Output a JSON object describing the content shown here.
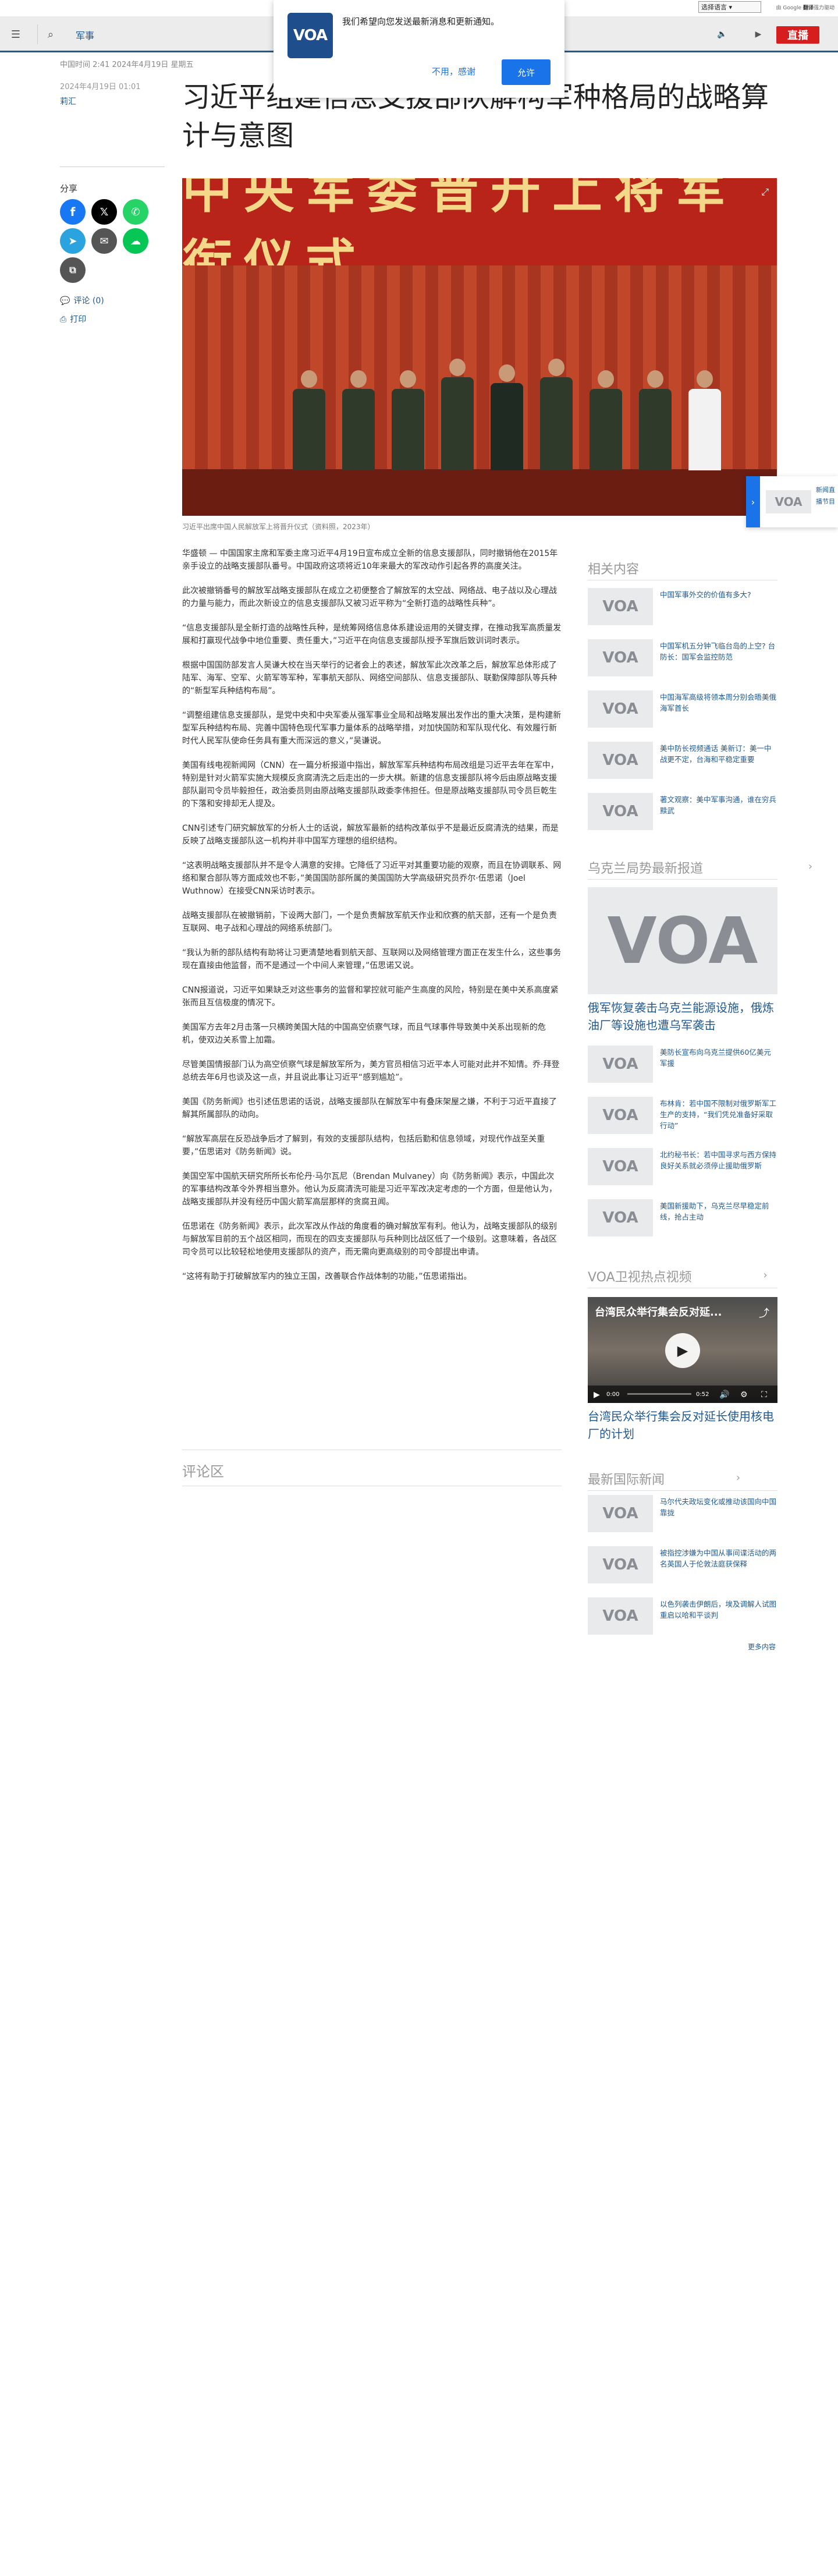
{
  "translate": {
    "select_value": "选择语言",
    "powered_by": "由",
    "brand": "Google",
    "service": "翻译",
    "action": "强力驱动"
  },
  "header": {
    "section": "军事",
    "live_label": "直播"
  },
  "notification": {
    "message": "我们希望向您发送最新消息和更新通知。",
    "decline": "不用，感谢",
    "accept": "允许",
    "logo_text": "VOA"
  },
  "article": {
    "dateline": "中国时间 2:41 2024年4月19日 星期五",
    "pubdate": "2024年4月19日 01:01",
    "author": "莉汇",
    "title": "习近平组建信息支援部队解构军种格局的战略算计与意图",
    "hero_banner_text": "中央军委晋升上将军衔仪式",
    "caption": "习近平出席中国人民解放军上将晋升仪式（资料照，2023年）",
    "paragraphs": [
      "华盛顿 — 中国国家主席和军委主席习近平4月19日宣布成立全新的信息支援部队，同时撤销他在2015年亲手设立的战略支援部队番号。中国政府这项将近10年来最大的军改动作引起各界的高度关注。",
      "此次被撤销番号的解放军战略支援部队在成立之初便整合了解放军的太空战、网络战、电子战以及心理战的力量与能力，而此次新设立的信息支援部队又被习近平称为“全新打造的战略性兵种”。",
      "“信息支援部队是全新打造的战略性兵种，是统筹网络信息体系建设运用的关键支撑，在推动我军高质量发展和打赢现代战争中地位重要、责任重大，”习近平在向信息支援部队授予军旗后致训词时表示。",
      "根据中国国防部发言人吴谦大校在当天举行的记者会上的表述，解放军此次改革之后，解放军总体形成了陆军、海军、空军、火箭军等军种，军事航天部队、网络空间部队、信息支援部队、联勤保障部队等兵种的“新型军兵种结构布局”。",
      "“调整组建信息支援部队，是党中央和中央军委从强军事业全局和战略发展出发作出的重大决策，是构建新型军兵种结构布局、完善中国特色现代军事力量体系的战略举措，对加快国防和军队现代化、有效履行新时代人民军队使命任务具有重大而深远的意义，”吴谦说。",
      "美国有线电视新闻网（CNN）在一篇分析报道中指出，解放军军兵种结构布局改组是习近平去年在军中，特别是针对火箭军实施大规模反贪腐清洗之后走出的一步大棋。新建的信息支援部队将今后由原战略支援部队副司令员毕毅担任，政治委员则由原战略支援部队政委李伟担任。但是原战略支援部队司令员巨乾生的下落和安排却无人提及。",
      "CNN引述专门研究解放军的分析人士的话说，解放军最新的结构改革似乎不是最近反腐清洗的结果，而是反映了战略支援部队这一机构并非中国军方理想的组织结构。",
      "“这表明战略支援部队并不是令人满意的安排。它降低了习近平对其重要功能的观察，而且在协调联系、网络和聚合部队等方面成效也不彰，”美国国防部所属的美国国防大学高级研究员乔尔·伍思诺（Joel Wuthnow）在接受CNN采访时表示。",
      "战略支援部队在被撤销前，下设两大部门，一个是负责解放军航天作业和欣赛的航天部，还有一个是负责互联网、电子战和心理战的网络系统部门。",
      "“我认为新的部队结构有助将让习更清楚地看到航天部、互联网以及网络管理方面正在发生什么，这些事务现在直接由他监督，而不是通过一个中间人来管理，”伍思诺又说。",
      "CNN报道说，习近平如果缺乏对这些事务的监督和掌控就可能产生高度的风险，特别是在美中关系高度紧张而且互信极度的情况下。",
      "美国军方去年2月击落一只横跨美国大陆的中国高空侦察气球，而且气球事件导致美中关系出现新的危机，使双边关系雪上加霜。",
      "尽管美国情报部门认为高空侦察气球是解放军所为，美方官员相信习近平本人可能对此并不知情。乔·拜登总统去年6月也谈及这一点，并且说此事让习近平“感到尴尬”。",
      "美国《防务新闻》也引述伍思诺的话说，战略支援部队在解放军中有叠床架屋之嫌，不利于习近平直接了解其所属部队的动向。",
      "“解放军高层在反恐战争后才了解到，有效的支援部队结构，包括后勤和信息领域，对现代作战至关重要，”伍思诺对《防务新闻》说。",
      "美国空军中国航天研究所所长布伦丹·马尔瓦尼（Brendan Mulvaney）向《防务新闻》表示，中国此次的军事结构改革令外界相当意外。他认为反腐清洗可能是习近平军改决定考虑的一个方面，但是他认为，战略支援部队并没有经历中国火箭军高层那样的贪腐丑闻。",
      "伍思诺在《防务新闻》表示，此次军改从作战的角度看的确对解放军有利。他认为，战略支援部队的级别与解放军目前的五个战区相同，而现在的四支支援部队与兵种则比战区低了一个级别。这意味着，各战区司令员可以比较轻松地使用支援部队的资产，而无需向更高级别的司令部提出申请。",
      "“这将有助于打破解放军内的独立王国，改善联合作战体制的功能，”伍思诺指出。"
    ],
    "comments_label": "评论区"
  },
  "share": {
    "label": "分享",
    "comments_link": "评论 (0)",
    "print_link": "打印"
  },
  "float_widget": {
    "logo_text": "VOA",
    "text": "新闻直播节目"
  },
  "sidebar": {
    "related": {
      "title": "相关内容",
      "items": [
        {
          "thumb": "VOA",
          "text": "中国军事外交的价值有多大?"
        },
        {
          "thumb": "VOA",
          "text": "中国军机五分钟飞临台岛的上空? 台防长：国军会监控防范"
        },
        {
          "thumb": "VOA",
          "text": "中国海军高级将领本周分别会晤美俄海军首长"
        },
        {
          "thumb": "VOA",
          "text": "美中防长视频通话 美新订：美一中战更不定，台海和平稳定重要"
        },
        {
          "thumb": "VOA",
          "text": "著文观察：美中军事沟通，谁在穷兵黩武"
        }
      ]
    },
    "ukraine": {
      "title": "乌克兰局势最新报道",
      "feature_thumb": "VOA",
      "feature_text": "俄军恢复袭击乌克兰能源设施，俄炼油厂等设施也遭乌军袭击",
      "items": [
        {
          "thumb": "VOA",
          "text": "美防长宣布向乌克兰提供60亿美元军援"
        },
        {
          "thumb": "VOA",
          "text": "布林肯：若中国不限制对俄罗斯军工生产的支持，“我们凭兑准备好采取行动”"
        },
        {
          "thumb": "VOA",
          "text": "北约秘书长：若中国寻求与西方保持良好关系就必须停止援助俄罗斯"
        },
        {
          "thumb": "VOA",
          "text": "美国新援助下，乌克兰尽早稳定前线，抢占主动"
        }
      ]
    },
    "video": {
      "title": "VOA卫视热点视频",
      "player_title": "台湾民众举行集会反对延...",
      "time_current": "0:00",
      "time_total": "0:52",
      "progress": 0,
      "caption": "台湾民众举行集会反对延长使用核电厂的计划"
    },
    "intl": {
      "title": "最新国际新闻",
      "items": [
        {
          "thumb": "VOA",
          "text": "马尔代夫政坛变化或推动该国向中国靠拢"
        },
        {
          "thumb": "VOA",
          "text": "被指控涉嫌为中国从事间谍活动的两名英国人于伦敦法庭获保释"
        },
        {
          "thumb": "VOA",
          "text": "以色列袭击伊朗后，埃及调解人试图重启以哈和平谈判"
        }
      ],
      "more_link": "更多内容"
    }
  }
}
